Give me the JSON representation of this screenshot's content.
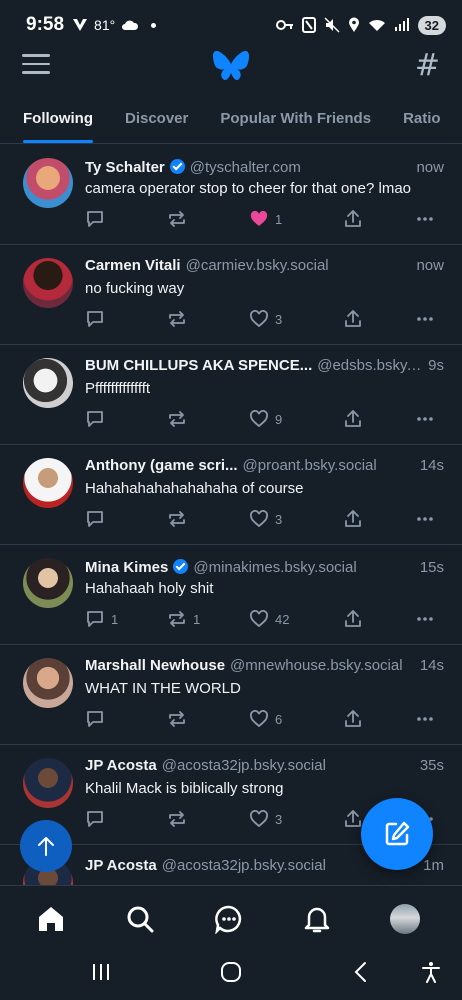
{
  "status_bar": {
    "time": "9:58",
    "temp": "81°",
    "battery": "32"
  },
  "header": {
    "menu_icon": "menu-icon",
    "logo": "butterfly-logo",
    "feeds_icon": "hash-icon"
  },
  "tabs": [
    {
      "label": "Following",
      "active": true
    },
    {
      "label": "Discover",
      "active": false
    },
    {
      "label": "Popular With Friends",
      "active": false
    },
    {
      "label": "Ratio",
      "active": false
    }
  ],
  "posts": [
    {
      "name": "Ty Schalter",
      "verified": true,
      "handle": "@tyschalter.com",
      "time": "now",
      "text": "camera operator stop to cheer for that one? lmao",
      "replies": "",
      "reposts": "",
      "likes": "1",
      "liked": true
    },
    {
      "name": "Carmen Vitali",
      "verified": false,
      "handle": "@carmiev.bsky.social",
      "time": "now",
      "text": "no fucking way",
      "replies": "",
      "reposts": "",
      "likes": "3",
      "liked": false
    },
    {
      "name": "BUM CHILLUPS AKA SPENCE...",
      "verified": false,
      "handle": "@edsbs.bsky....",
      "time": "9s",
      "text": "Pffffffffffffft",
      "replies": "",
      "reposts": "",
      "likes": "9",
      "liked": false
    },
    {
      "name": "Anthony (game scri...",
      "verified": false,
      "handle": "@proant.bsky.social",
      "time": "14s",
      "text": "Hahahahahahahahaha of course",
      "replies": "",
      "reposts": "",
      "likes": "3",
      "liked": false
    },
    {
      "name": "Mina Kimes",
      "verified": true,
      "handle": "@minakimes.bsky.social",
      "time": "15s",
      "text": "Hahahaah holy shit",
      "replies": "1",
      "reposts": "1",
      "likes": "42",
      "liked": false
    },
    {
      "name": "Marshall Newhouse",
      "verified": false,
      "handle": "@mnewhouse.bsky.social",
      "time": "14s",
      "text": "WHAT IN THE WORLD",
      "replies": "",
      "reposts": "",
      "likes": "6",
      "liked": false
    },
    {
      "name": "JP Acosta",
      "verified": false,
      "handle": "@acosta32jp.bsky.social",
      "time": "35s",
      "text": "Khalil Mack is biblically strong",
      "replies": "",
      "reposts": "",
      "likes": "3",
      "liked": false
    },
    {
      "name": "JP Acosta",
      "verified": false,
      "handle": "@acosta32jp.bsky.social",
      "time": "1m",
      "text": "",
      "replies": "",
      "reposts": "",
      "likes": "",
      "liked": false
    }
  ],
  "colors": {
    "background": "#161e27",
    "accent": "#1083fe",
    "like": "#ec4899",
    "muted": "#8b98a8",
    "divider": "#2e3a48"
  },
  "bottom_nav": [
    "home-icon",
    "search-icon",
    "chat-icon",
    "notifications-icon",
    "profile-avatar"
  ],
  "system_nav": [
    "recents-button",
    "home-button",
    "back-button",
    "accessibility-button"
  ]
}
